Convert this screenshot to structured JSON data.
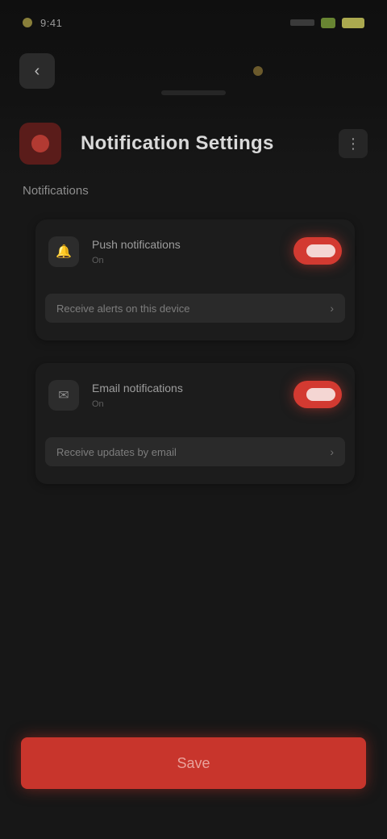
{
  "status_bar": {
    "time": "9:41",
    "battery_color": "#c7c45a"
  },
  "toolbar": {
    "back_icon": "chevron-left-icon",
    "back_glyph": "‹"
  },
  "header": {
    "title": "Notification Settings",
    "badge_icon": "app-icon",
    "action_icon": "more-icon",
    "action_glyph": "⋮"
  },
  "section": {
    "label": "Notifications"
  },
  "cards": [
    {
      "title": "Push notifications",
      "subtitle": "On",
      "toggle_on": true,
      "field_text": "Receive alerts on this device",
      "field_icon": "chevron-right-icon",
      "icon_glyph": "›"
    },
    {
      "title": "Email notifications",
      "subtitle": "On",
      "toggle_on": true,
      "field_text": "Receive updates by email",
      "field_icon": "chevron-right-icon",
      "icon_glyph": "›"
    }
  ],
  "primary_action": {
    "label": "Save"
  },
  "colors": {
    "accent": "#d33a31",
    "background": "#171717",
    "card": "#1c1c1c"
  }
}
